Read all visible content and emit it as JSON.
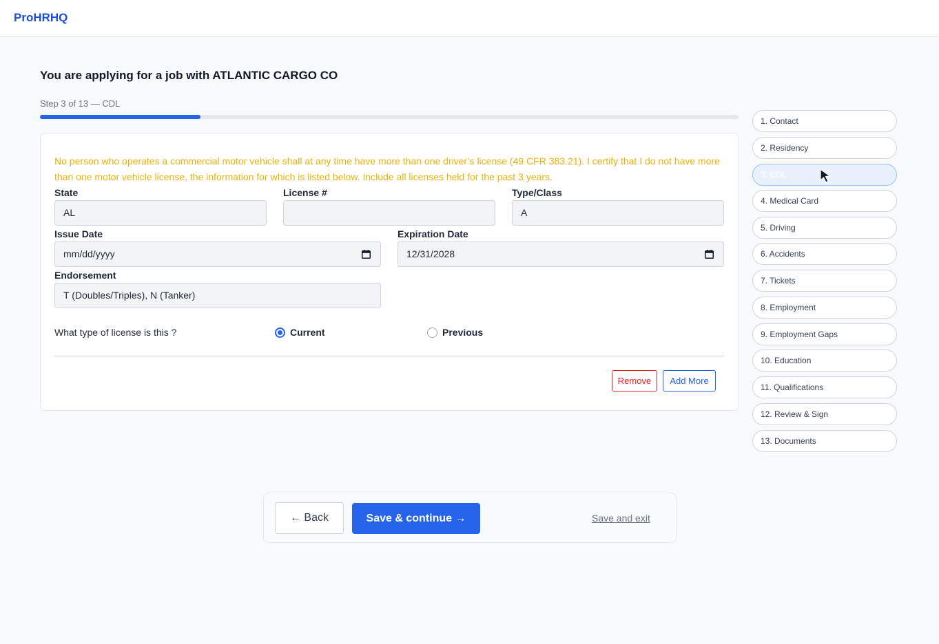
{
  "header": {
    "brand": "ProHRHQ"
  },
  "page": {
    "job_title": "You are applying for a job with ATLANTIC CARGO CO",
    "step_label": "Step 3 of 13 — CDL",
    "progress_percent": 23
  },
  "form": {
    "notice": "No person who operates a commercial motor vehicle shall at any time have more than one driver’s license (49 CFR 383.21). I certify that I do not have more than one motor vehicle license, the information for which is listed below. Include all licenses held for the past 3 years.",
    "state": {
      "label": "State",
      "value": "AL"
    },
    "license": {
      "label": "License #",
      "value": ""
    },
    "type_class": {
      "label": "Type/Class",
      "value": "A"
    },
    "issue_date": {
      "label": "Issue Date",
      "value": "mm/dd/yyyy"
    },
    "expiration_date": {
      "label": "Expiration Date",
      "value": "12/31/2028"
    },
    "endorsement": {
      "label": "Endorsement",
      "value": "T (Doubles/Triples), N (Tanker)"
    },
    "license_type_question": "What type of license is this ?",
    "license_type_options": [
      {
        "label": "Current",
        "selected": true
      },
      {
        "label": "Previous",
        "selected": false
      }
    ],
    "remove_label": "Remove",
    "add_more_label": "Add More"
  },
  "sidebar": {
    "active_index": 2,
    "items": [
      {
        "label": "1. Contact"
      },
      {
        "label": "2. Residency"
      },
      {
        "label": "3. CDL"
      },
      {
        "label": "4. Medical Card"
      },
      {
        "label": "5. Driving"
      },
      {
        "label": "6. Accidents"
      },
      {
        "label": "7. Tickets"
      },
      {
        "label": "8. Employment"
      },
      {
        "label": "9. Employment Gaps"
      },
      {
        "label": "10. Education"
      },
      {
        "label": "11. Qualifications"
      },
      {
        "label": "12. Review & Sign"
      },
      {
        "label": "13. Documents"
      }
    ]
  },
  "footer": {
    "back_label": "← Back",
    "save_continue_label": "Save & continue →",
    "save_exit_label": "Save and exit"
  },
  "colors": {
    "accent": "#2563eb",
    "brand": "#1d4ed8",
    "notice": "#eab308",
    "danger": "#dc2626"
  }
}
